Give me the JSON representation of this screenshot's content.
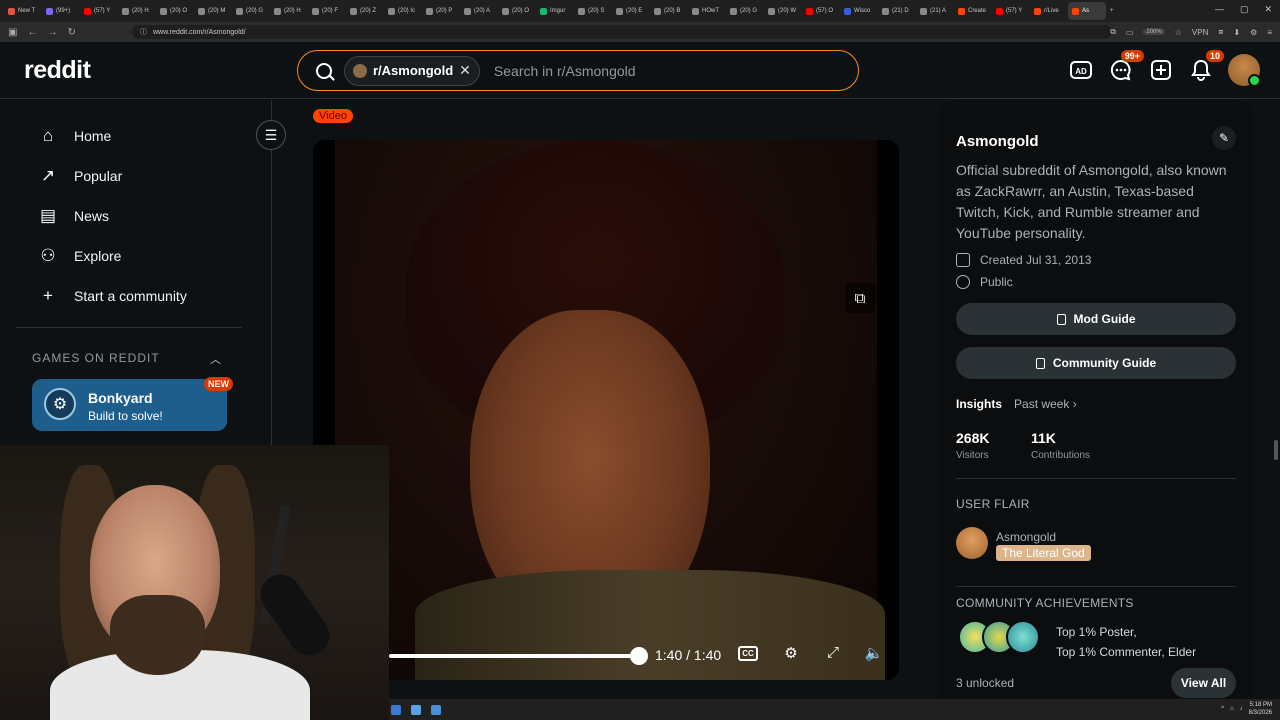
{
  "browser": {
    "tabs": [
      {
        "label": "New T",
        "color": "#e0533d"
      },
      {
        "label": "(99+)",
        "color": "#7b68ee"
      },
      {
        "label": "(57) Y",
        "color": "#ff0000"
      },
      {
        "label": "(20) H",
        "color": "#888888"
      },
      {
        "label": "(20) O",
        "color": "#888888"
      },
      {
        "label": "(20) M",
        "color": "#888888"
      },
      {
        "label": "(20) G",
        "color": "#888888"
      },
      {
        "label": "(20) H",
        "color": "#888888"
      },
      {
        "label": "(20) F",
        "color": "#888888"
      },
      {
        "label": "(20) Z",
        "color": "#888888"
      },
      {
        "label": "(20) Ic",
        "color": "#888888"
      },
      {
        "label": "(20) P",
        "color": "#888888"
      },
      {
        "label": "(20) A",
        "color": "#888888"
      },
      {
        "label": "(20) O",
        "color": "#888888"
      },
      {
        "label": "Imgur",
        "color": "#1bb76e"
      },
      {
        "label": "(20) S",
        "color": "#888888"
      },
      {
        "label": "(20) E",
        "color": "#888888"
      },
      {
        "label": "(20) B",
        "color": "#888888"
      },
      {
        "label": "HOwT",
        "color": "#888888"
      },
      {
        "label": "(20) G",
        "color": "#888888"
      },
      {
        "label": "(20) W",
        "color": "#888888"
      },
      {
        "label": "(57) O",
        "color": "#ff0000"
      },
      {
        "label": "Wisco",
        "color": "#3b5bdb"
      },
      {
        "label": "(21) D",
        "color": "#888888"
      },
      {
        "label": "(21) A",
        "color": "#888888"
      },
      {
        "label": "Create",
        "color": "#ff4500"
      },
      {
        "label": "(57) Y",
        "color": "#ff0000"
      },
      {
        "label": "r/Live",
        "color": "#ff4500"
      },
      {
        "label": "As",
        "color": "#ff4500",
        "active": true
      }
    ],
    "url": "www.reddit.com/r/Asmongold/",
    "zoom": "200%",
    "vpn": "VPN"
  },
  "header": {
    "logo": "reddit",
    "search_chip": "r/Asmongold",
    "search_placeholder": "Search in r/Asmongold",
    "chat_badge": "99+",
    "notif_badge": "10"
  },
  "sidebar": {
    "items": [
      {
        "label": "Home",
        "icon": "home-icon",
        "glyph": "⌂"
      },
      {
        "label": "Popular",
        "icon": "popular-icon",
        "glyph": "↗"
      },
      {
        "label": "News",
        "icon": "news-icon",
        "glyph": "▤"
      },
      {
        "label": "Explore",
        "icon": "explore-icon",
        "glyph": "⚇"
      },
      {
        "label": "Start a community",
        "icon": "plus-icon",
        "glyph": "+"
      }
    ],
    "games_title": "GAMES ON REDDIT",
    "game": {
      "name": "Bonkyard",
      "subtitle": "Build to solve!",
      "badge": "NEW"
    }
  },
  "post": {
    "flair": "Video",
    "video": {
      "time": "1:40 / 1:40",
      "progress": 1.0
    }
  },
  "community": {
    "name": "Asmongold",
    "description": "Official subreddit of Asmongold, also known as ZackRawrr, an Austin, Texas-based Twitch, Kick, and Rumble streamer and YouTube personality.",
    "created": "Created Jul 31, 2013",
    "visibility": "Public",
    "mod_guide": "Mod Guide",
    "community_guide": "Community Guide",
    "insights_label": "Insights",
    "insights_period": "Past week ›",
    "visitors": {
      "value": "268K",
      "label": "Visitors"
    },
    "contributions": {
      "value": "11K",
      "label": "Contributions"
    },
    "user_flair_title": "USER FLAIR",
    "user_name": "Asmongold",
    "user_flair": "The Literal God",
    "achievements_title": "COMMUNITY ACHIEVEMENTS",
    "achievement_1": "Top 1% Poster,",
    "achievement_2": "Top 1% Commenter, Elder",
    "unlocked": "3 unlocked",
    "view_all": "View All"
  },
  "taskbar": {
    "time": "5:18 PM",
    "date": "8/3/2026"
  },
  "colors": {
    "accent": "#ff4500",
    "search_border": "#ff8b1a",
    "game_card": "#1d5e8c",
    "badge": "#d93a00"
  }
}
